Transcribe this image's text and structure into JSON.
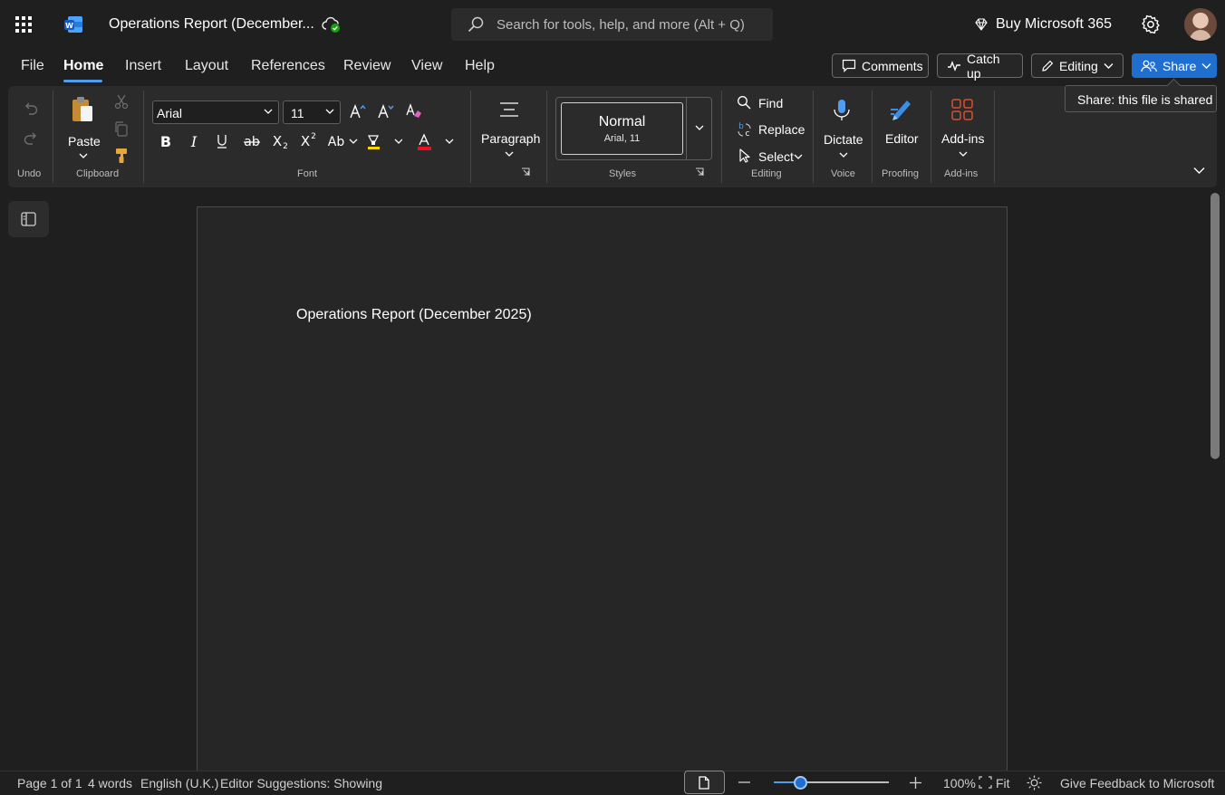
{
  "app": {
    "doc_title": "Operations Report (December...",
    "search_placeholder": "Search for tools, help, and more (Alt + Q)",
    "buy_label": "Buy Microsoft 365"
  },
  "menu": {
    "items": [
      "File",
      "Home",
      "Insert",
      "Layout",
      "References",
      "Review",
      "View",
      "Help"
    ],
    "active": "Home",
    "comments_label": "Comments",
    "catchup_label": "Catch up",
    "editing_label": "Editing",
    "share_label": "Share"
  },
  "tooltip": {
    "text": "Share: this file is shared"
  },
  "ribbon": {
    "groups": {
      "undo": "Undo",
      "clipboard": "Clipboard",
      "font": "Font",
      "styles": "Styles",
      "editing": "Editing",
      "voice": "Voice",
      "proofing": "Proofing",
      "addins": "Add-ins"
    },
    "paste_label": "Paste",
    "font_name": "Arial",
    "font_size": "11",
    "paragraph_label": "Paragraph",
    "style_name": "Normal",
    "style_sub": "Arial, 11",
    "find_label": "Find",
    "replace_label": "Replace",
    "select_label": "Select",
    "dictate_label": "Dictate",
    "editor_label": "Editor",
    "addins_label": "Add-ins",
    "font_color": "#e81123",
    "highlight_color": "#f5d600"
  },
  "document": {
    "body_text": "Operations Report (December 2025)"
  },
  "status": {
    "page": "Page 1 of 1",
    "words": "4 words",
    "language": "English (U.K.)",
    "editor": "Editor Suggestions: Showing",
    "zoom": "100%",
    "zoom_level": 0.23,
    "fit": "Fit",
    "feedback": "Give Feedback to Microsoft"
  },
  "colors": {
    "accent": "#1f6fd1",
    "brand_word": "#2b7cd3"
  }
}
